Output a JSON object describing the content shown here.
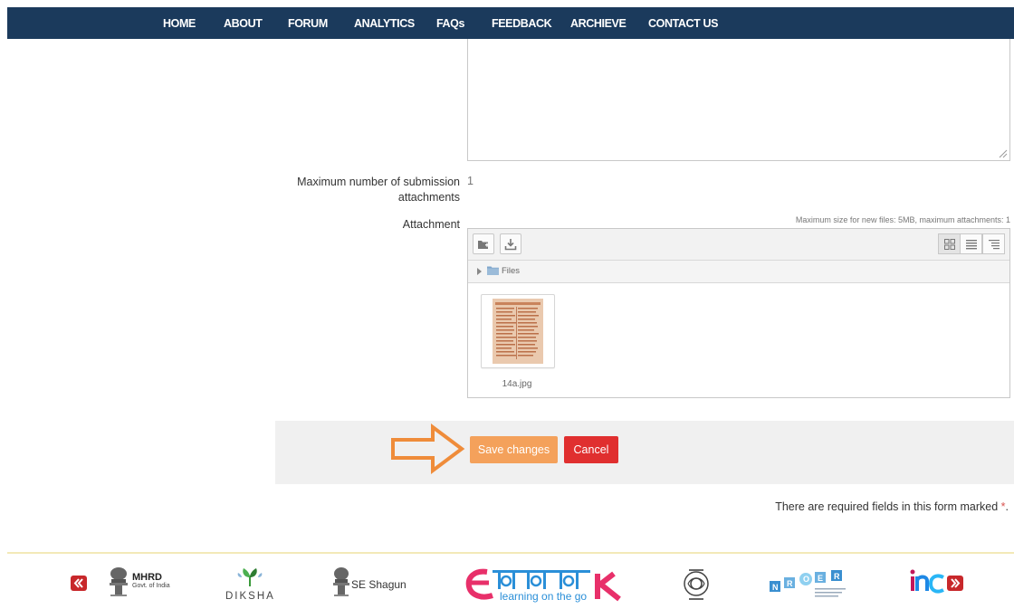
{
  "nav": {
    "items": [
      "HOME",
      "ABOUT",
      "FORUM",
      "ANALYTICS",
      "FAQs",
      "FEEDBACK",
      "ARCHIEVE",
      "CONTACT US"
    ],
    "background": "#1b3a5c"
  },
  "form": {
    "max_attachments_label": "Maximum number of submission attachments",
    "max_attachments_value": "1",
    "attachment_label": "Attachment",
    "max_size_note": "Maximum size for new files: 5MB, maximum attachments: 1"
  },
  "filepicker": {
    "path_label": "Files",
    "file_name": "14a.jpg",
    "icons": [
      "add-file-icon",
      "download-icon",
      "grid-view-icon",
      "list-view-icon",
      "tree-view-icon",
      "folder-icon"
    ]
  },
  "buttons": {
    "save": "Save changes",
    "cancel": "Cancel",
    "save_color": "#f4a15b",
    "cancel_color": "#e02f2f"
  },
  "required_note": {
    "text": "There are required fields in this form marked",
    "star": "*",
    "end": "."
  },
  "footer": {
    "mhrd_title": "MHRD",
    "mhrd_sub": "Govt. of India",
    "diksha": "DIKSHA",
    "shagun": "SE Shagun",
    "epathshala_sub": "learning on the go",
    "nroer": "NROER"
  }
}
